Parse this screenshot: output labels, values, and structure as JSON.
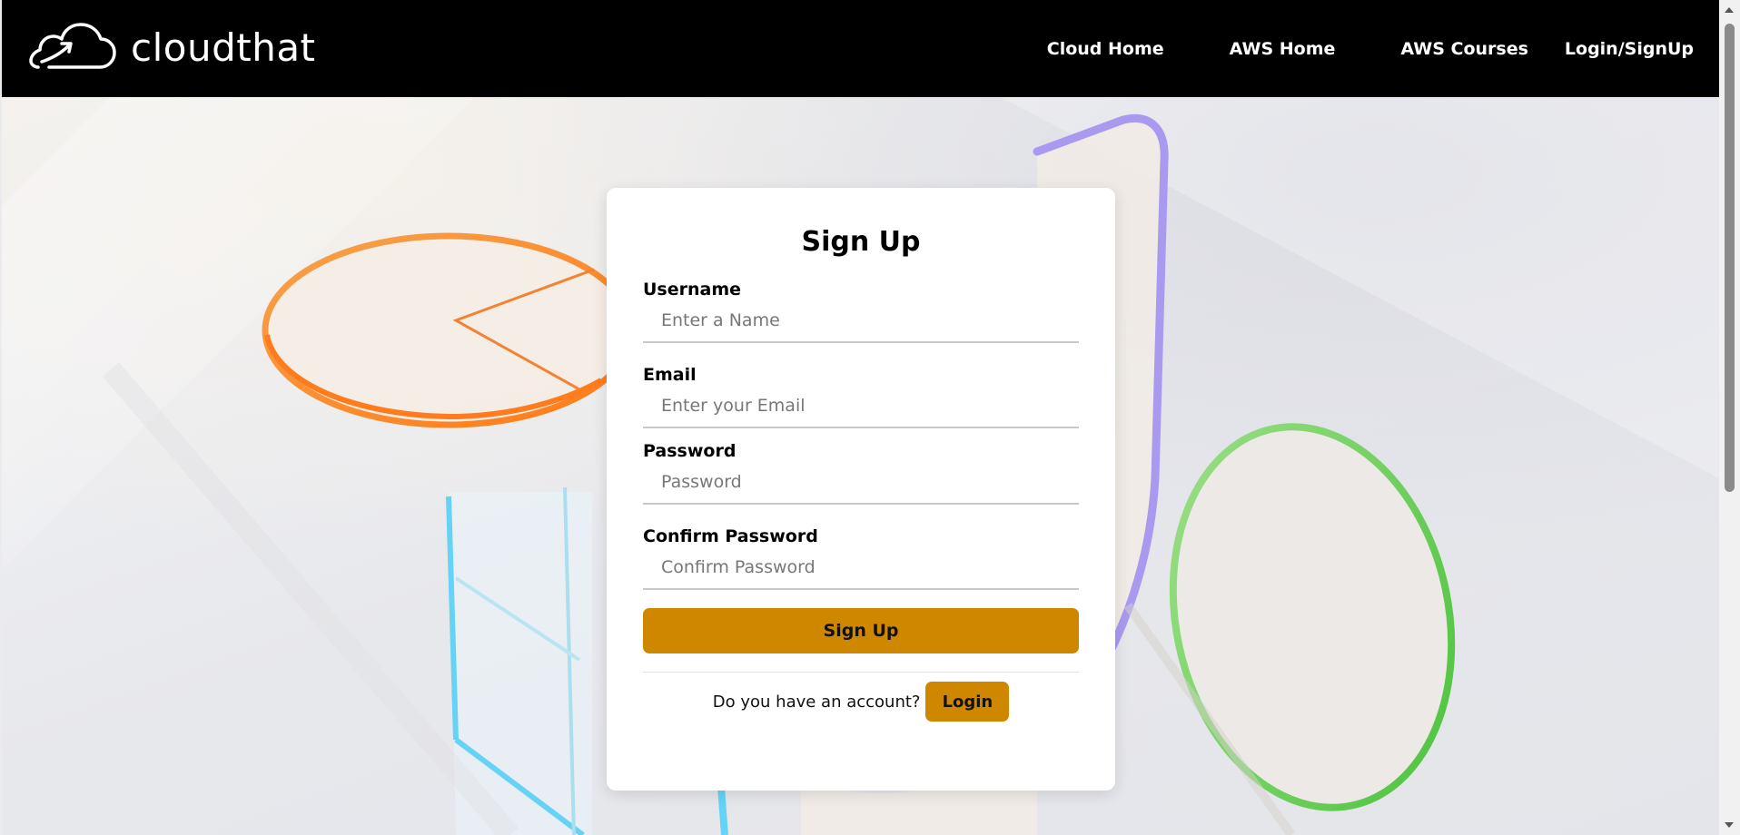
{
  "brand": {
    "name": "cloudthat",
    "logo_icon": "cloud-arrow-icon"
  },
  "nav": {
    "items": [
      {
        "label": "Cloud Home"
      },
      {
        "label": "AWS Home"
      },
      {
        "label": "AWS Courses"
      },
      {
        "label": "Login/SignUp"
      }
    ]
  },
  "form": {
    "title": "Sign Up",
    "username": {
      "label": "Username",
      "placeholder": "Enter a Name",
      "value": ""
    },
    "email": {
      "label": "Email",
      "placeholder": "Enter your Email",
      "value": ""
    },
    "password": {
      "label": "Password",
      "placeholder": "Password",
      "value": ""
    },
    "confirm_password": {
      "label": "Confirm Password",
      "placeholder": "Confirm Password",
      "value": ""
    },
    "submit_label": "Sign Up",
    "account_prompt": "Do you have an account?",
    "login_label": "Login"
  },
  "colors": {
    "navbar_bg": "#000000",
    "accent": "#d08700",
    "card_bg": "#ffffff"
  }
}
